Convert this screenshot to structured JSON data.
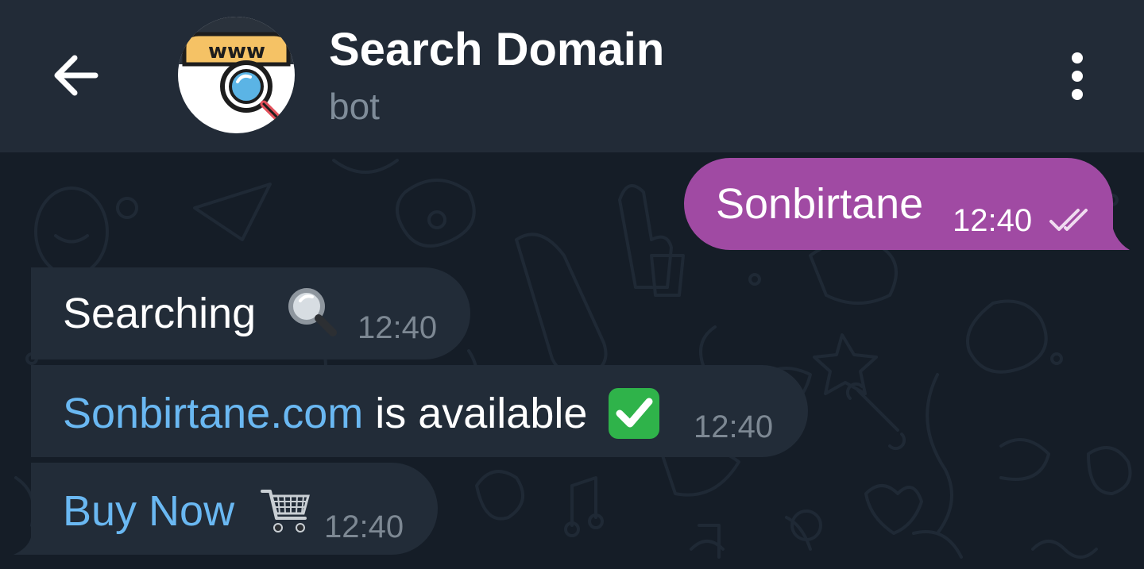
{
  "header": {
    "title": "Search Domain",
    "subtitle": "bot",
    "avatar_label": "www",
    "back_icon": "arrow-left-icon",
    "menu_icon": "more-vertical-icon"
  },
  "messages": [
    {
      "direction": "outgoing",
      "text": "Sonbirtane",
      "time": "12:40",
      "status": "read"
    },
    {
      "direction": "incoming",
      "text": "Searching",
      "emoji": "magnifier-icon",
      "time": "12:40"
    },
    {
      "direction": "incoming",
      "link": "Sonbirtane.com",
      "text": " is available",
      "emoji": "check-mark-icon",
      "time": "12:40"
    },
    {
      "direction": "incoming",
      "link": "Buy Now",
      "emoji": "shopping-cart-icon",
      "time": "12:40"
    }
  ],
  "colors": {
    "background": "#151d27",
    "header": "#222b37",
    "outgoing_bubble": "#a04aa3",
    "incoming_bubble": "#222c38",
    "link": "#6ab8f2",
    "timestamp": "#7d8893",
    "accent_check": "#2fb34a"
  }
}
